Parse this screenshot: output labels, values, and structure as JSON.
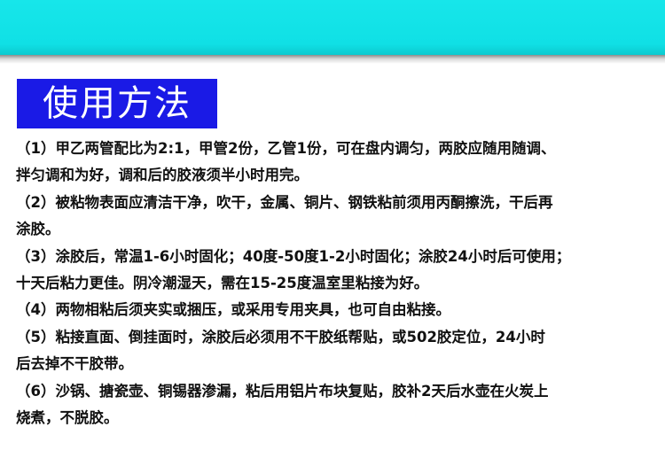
{
  "title": "使用方法",
  "lines": [
    "（1）甲乙两管配比为2:1，甲管2份，乙管1份，可在盘内调匀，两胶应随用随调、",
    "拌匀调和为好，调和后的胶液须半小时用完。",
    "（2）被粘物表面应清洁干净，吹干，金属、铜片、钢铁粘前须用丙酮擦洗，干后再",
    "涂胶。",
    "（3）涂胶后，常温1-6小时固化；40度-50度1-2小时固化；涂胶24小时后可使用；",
    "十天后粘力更佳。阴冷潮湿天，需在15-25度温室里粘接为好。",
    "（4）两物相粘后须夹实或捆压，或采用专用夹具，也可自由粘接。",
    "（5）粘接直面、倒挂面时，涂胶后必须用不干胶纸帮贴，或502胶定位，24小时",
    "后去掉不干胶带。",
    "（6）沙锅、搪瓷壶、铜锡器渗漏，粘后用铝片布块复贴，胶补2天后水壶在火炭上",
    "烧煮，不脱胶。"
  ],
  "colors": {
    "band": "#10e0e5",
    "title_bg": "#1a1ae6",
    "title_text": "#ffffff",
    "body_text": "#111111"
  }
}
